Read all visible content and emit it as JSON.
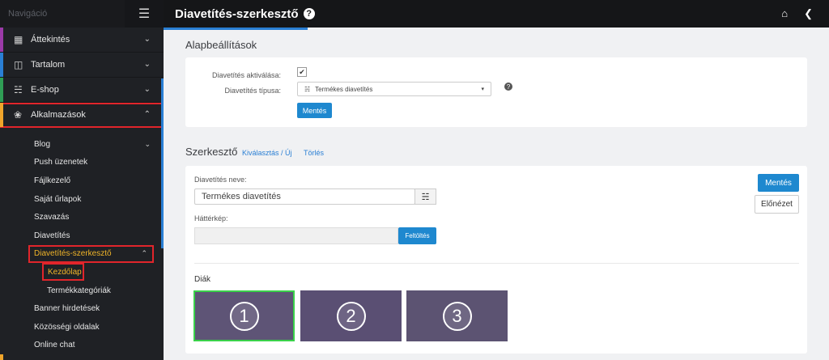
{
  "nav": {
    "header": "Navigáció",
    "menu_icon": "hamburger-icon",
    "items": [
      {
        "label": "Áttekintés",
        "icon": "grid-icon",
        "color": "#9b3aa8"
      },
      {
        "label": "Tartalom",
        "icon": "layout-icon",
        "color": "#2a7fd4"
      },
      {
        "label": "E-shop",
        "icon": "basket-icon",
        "color": "#2f9e55"
      },
      {
        "label": "Alkalmazások",
        "icon": "apps-icon",
        "color": "#e1252b"
      }
    ],
    "sub": {
      "blog": "Blog",
      "push": "Push üzenetek",
      "files": "Fájlkezelő",
      "forms": "Saját űrlapok",
      "vote": "Szavazás",
      "slideshow": "Diavetítés",
      "editor": "Diavetítés-szerkesztő",
      "home": "Kezdőlap",
      "categories": "Termékkategóriák",
      "banner": "Banner hirdetések",
      "social": "Közösségi oldalak",
      "chat": "Online chat"
    }
  },
  "topbar": {
    "title": "Diavetítés-szerkesztő",
    "help": "?",
    "home_icon": "home-icon",
    "back_icon": "chevron-left-icon"
  },
  "basic": {
    "title": "Alapbeállítások",
    "enable_label": "Diavetítés aktiválása:",
    "enable_checked": true,
    "type_label": "Diavetítés típusa:",
    "type_value": "Termékes diavetítés",
    "save": "Mentés",
    "help": "?"
  },
  "editor": {
    "title": "Szerkesztő",
    "select_link": "Kiválasztás / Új",
    "delete_link": "Törlés",
    "name_label": "Diavetítés neve:",
    "name_value": "Termékes diavetítés",
    "bg_label": "Háttérkép:",
    "upload": "Feltöltés",
    "save": "Mentés",
    "preview": "Előnézet",
    "slides_label": "Diák",
    "slides": [
      "1",
      "2",
      "3"
    ]
  }
}
